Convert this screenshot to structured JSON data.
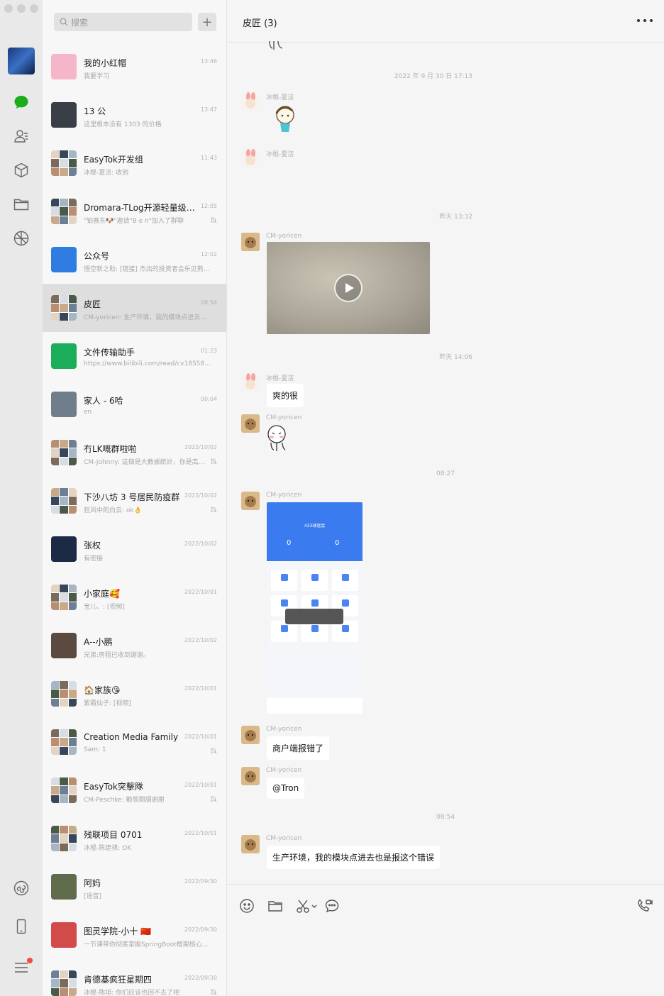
{
  "sidebar": {
    "icons": [
      "chat-icon",
      "contacts-icon",
      "box-icon",
      "folder-icon",
      "moments-icon",
      "mini-program-icon",
      "phone-icon",
      "menu-icon"
    ]
  },
  "search": {
    "placeholder": "搜索",
    "add": "+"
  },
  "conversations": [
    {
      "name": "我的小红帽",
      "time": "13:46",
      "preview": "我要学习",
      "muted": false,
      "selected": false,
      "avatar_color": "#f4b6c8"
    },
    {
      "name": "13 公",
      "time": "13:47",
      "preview": "这里根本没有 1303 的价格",
      "muted": false,
      "selected": false,
      "avatar_color": "#3a3f47"
    },
    {
      "name": "EasyTok开发组",
      "time": "11:43",
      "preview": "冰棍-夏洁: 收到",
      "muted": false,
      "selected": false,
      "avatar_color": "#8fa3b8"
    },
    {
      "name": "Dromara-TLog开源轻量级日…",
      "time": "12:05",
      "preview": "\"铂赛东🐶\"邀请\"B e n\"加入了群聊",
      "muted": true,
      "selected": false,
      "avatar_color": "#9d8f7f"
    },
    {
      "name": "公众号",
      "time": "12:02",
      "preview": "悟空新之助: [链接] 杰出的投资者会乐见熊…",
      "muted": false,
      "selected": false,
      "avatar_color": "#2f7de1"
    },
    {
      "name": "皮匠",
      "time": "08:54",
      "preview": "CM-yoricen: 生产环境，我的模块点进去也…",
      "muted": false,
      "selected": true,
      "avatar_color": "#4d5f7a"
    },
    {
      "name": "文件传输助手",
      "time": "01:23",
      "preview": "https://www.bilibili.com/read/cv18558541",
      "muted": false,
      "selected": false,
      "avatar_color": "#1aad5a"
    },
    {
      "name": "家人 - 6哈",
      "time": "00:04",
      "preview": "en",
      "muted": false,
      "selected": false,
      "avatar_color": "#6f7e8a"
    },
    {
      "name": "冇LK嘅群啦啦",
      "time": "2022/10/02",
      "preview": "CM-Johnny: 這個是大數據統計，你是高…",
      "muted": true,
      "selected": false,
      "avatar_color": "#8a8f99"
    },
    {
      "name": "下沙八坊 3 号居民防疫群",
      "time": "2022/10/02",
      "preview": "狂风中的白云: ok👌",
      "muted": true,
      "selected": false,
      "avatar_color": "#6e6e6e"
    },
    {
      "name": "张权",
      "time": "2022/10/02",
      "preview": "有密接",
      "muted": false,
      "selected": false,
      "avatar_color": "#1d2a46"
    },
    {
      "name": "小家庭🥰",
      "time": "2022/10/01",
      "preview": "宝儿、: [视频]",
      "muted": false,
      "selected": false,
      "avatar_color": "#7d8a7a"
    },
    {
      "name": "A--小鹏",
      "time": "2022/10/02",
      "preview": "兄弟:房租已收到谢谢。",
      "muted": false,
      "selected": false,
      "avatar_color": "#5a4a40"
    },
    {
      "name": "🏠家族😘",
      "time": "2022/10/01",
      "preview": "紫霞仙子: [视频]",
      "muted": false,
      "selected": false,
      "avatar_color": "#8b7b6b"
    },
    {
      "name": "Creation Media Family",
      "time": "2022/10/01",
      "preview": "Sam: 1",
      "muted": true,
      "selected": false,
      "avatar_color": "#6a7890"
    },
    {
      "name": "EasyTok突擊隊",
      "time": "2022/10/01",
      "preview": "CM-Peschke: 動態閱讀謝謝",
      "muted": true,
      "selected": false,
      "avatar_color": "#7a8899"
    },
    {
      "name": "残联项目 0701",
      "time": "2022/10/01",
      "preview": "冰棍-陈建祺: OK",
      "muted": false,
      "selected": false,
      "avatar_color": "#3a4a6a"
    },
    {
      "name": "阿妈",
      "time": "2022/09/30",
      "preview": "[语音]",
      "muted": false,
      "selected": false,
      "avatar_color": "#5f6b4a"
    },
    {
      "name": "图灵学院-小十 🇨🇳",
      "time": "2022/09/30",
      "preview": "一节课带你彻底掌握SpringBoot框架核心—…",
      "muted": false,
      "selected": false,
      "avatar_color": "#d24a4a"
    },
    {
      "name": "肯德基疯狂星期四",
      "time": "2022/09/30",
      "preview": "冰棍-熊坦: 你们应该也回不去了吧",
      "muted": true,
      "selected": false,
      "avatar_color": "#5d6a7a"
    }
  ],
  "chat": {
    "title": "皮匠 (3)",
    "timestamps": [
      "2022 年 9 月 30 日 17:13",
      "昨天 13:32",
      "昨天 14:06",
      "08:27",
      "08:54"
    ],
    "messages": [
      {
        "sender": "冰棍-夏洁",
        "type": "sticker"
      },
      {
        "sender": "冰棍-夏洁",
        "type": "empty"
      },
      {
        "sender": "CM-yoricen",
        "type": "video"
      },
      {
        "sender": "冰棍-夏洁",
        "type": "text",
        "text": "爽的很"
      },
      {
        "sender": "CM-yoricen",
        "type": "sticker"
      },
      {
        "sender": "CM-yoricen",
        "type": "image"
      },
      {
        "sender": "CM-yoricen",
        "type": "text",
        "text": "商户端报错了"
      },
      {
        "sender": "CM-yoricen",
        "type": "text",
        "text": "@Tron"
      },
      {
        "sender": "CM-yoricen",
        "type": "text",
        "text": "生产环境，我的模块点进去也是报这个错误"
      }
    ],
    "phone_screenshot": {
      "header": "433球迷会",
      "stat_left": "0",
      "stat_right": "0"
    }
  },
  "composer": {
    "tools": [
      "emoji-icon",
      "folder-icon",
      "scissors-icon",
      "chat-bubble-icon",
      "call-icon"
    ]
  },
  "colors": {
    "accent": "#1aad19",
    "selected_row": "#dedede",
    "bubble": "#ffffff",
    "phone_blue": "#3b7bf0"
  }
}
